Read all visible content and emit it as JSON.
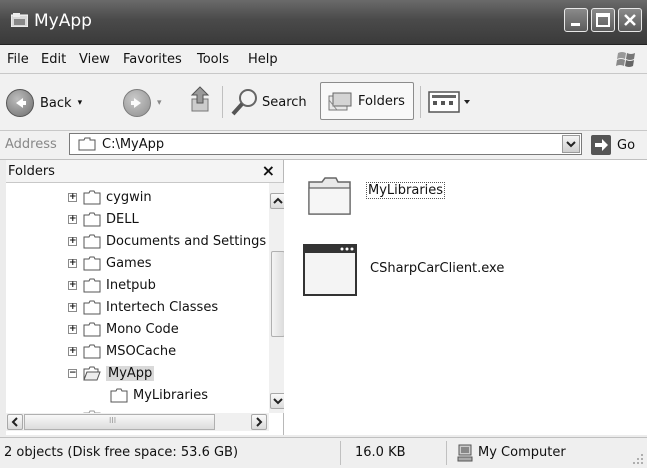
{
  "window": {
    "title": "MyApp"
  },
  "menu": [
    "File",
    "Edit",
    "View",
    "Favorites",
    "Tools",
    "Help"
  ],
  "toolbar": {
    "back": "Back",
    "search": "Search",
    "folders": "Folders"
  },
  "address": {
    "label": "Address",
    "value": "C:\\MyApp",
    "go": "Go"
  },
  "folders_pane": {
    "title": "Folders",
    "close": "×",
    "items": [
      {
        "label": "cygwin",
        "expander": "+"
      },
      {
        "label": "DELL",
        "expander": "+"
      },
      {
        "label": "Documents and Settings",
        "expander": "+"
      },
      {
        "label": "Games",
        "expander": "+"
      },
      {
        "label": "Inetpub",
        "expander": "+"
      },
      {
        "label": "Intertech Classes",
        "expander": "+"
      },
      {
        "label": "Mono Code",
        "expander": "+"
      },
      {
        "label": "MSOCache",
        "expander": "+"
      },
      {
        "label": "MyApp",
        "expander": "−",
        "selected": true
      },
      {
        "label": "MyLibraries",
        "expander": ""
      }
    ],
    "hscroll_mark": "III"
  },
  "content": {
    "items": [
      {
        "label": "MyLibraries",
        "icon": "folder-icon"
      },
      {
        "label": "CSharpCarClient.exe",
        "icon": "application-icon"
      }
    ]
  },
  "status": {
    "objects": "2 objects (Disk free space: 53.6 GB)",
    "size": "16.0 KB",
    "location": "My Computer"
  }
}
